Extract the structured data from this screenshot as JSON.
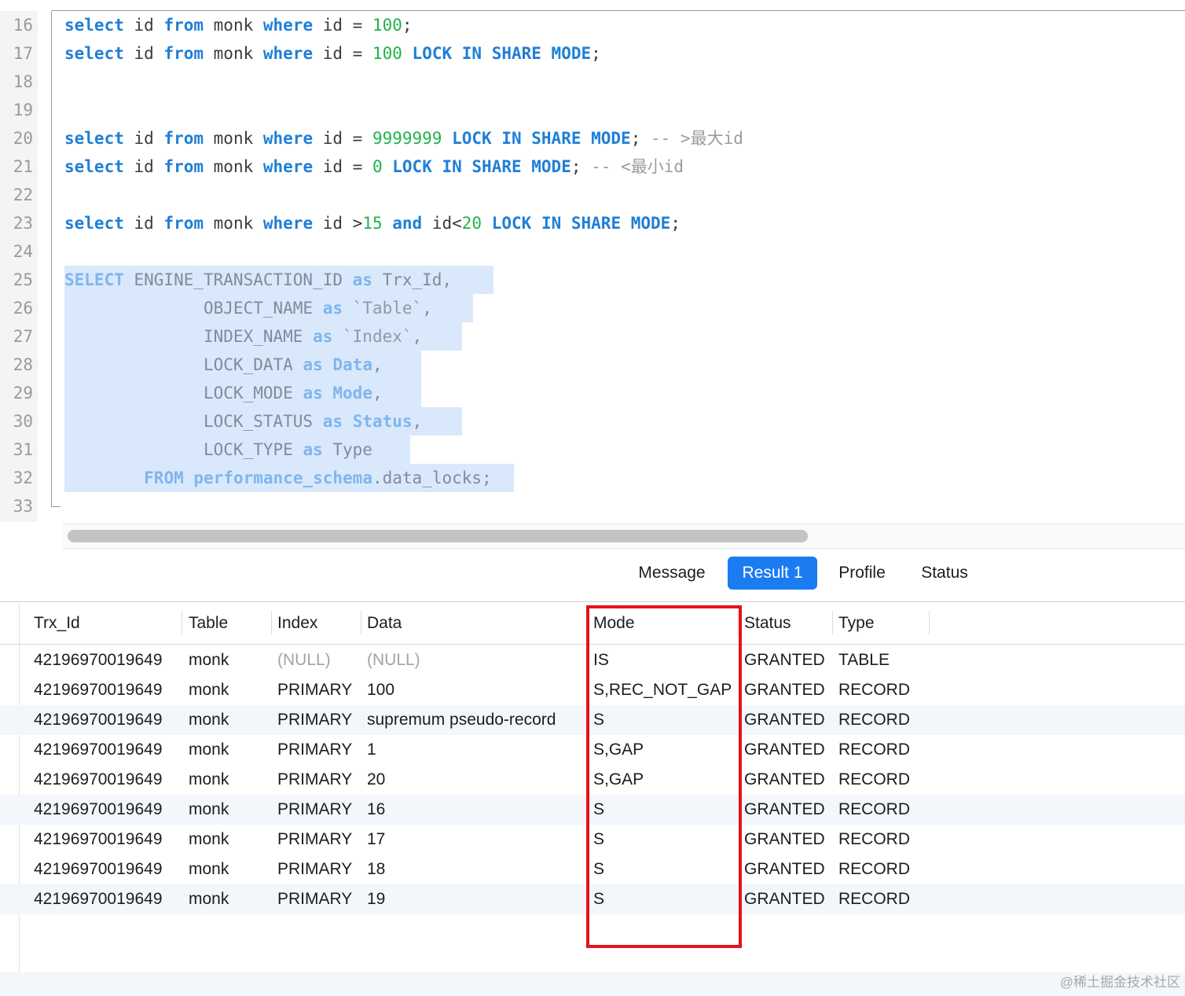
{
  "editor": {
    "lines": [
      {
        "no": "16",
        "segs": [
          [
            "k",
            "select"
          ],
          [
            "t",
            " id "
          ],
          [
            "k",
            "from"
          ],
          [
            "t",
            " monk "
          ],
          [
            "k",
            "where"
          ],
          [
            "t",
            " id = "
          ],
          [
            "n",
            "100"
          ],
          [
            "t",
            ";"
          ]
        ]
      },
      {
        "no": "17",
        "segs": [
          [
            "k",
            "select"
          ],
          [
            "t",
            " id "
          ],
          [
            "k",
            "from"
          ],
          [
            "t",
            " monk "
          ],
          [
            "k",
            "where"
          ],
          [
            "t",
            " id = "
          ],
          [
            "n",
            "100"
          ],
          [
            "t",
            " "
          ],
          [
            "k",
            "LOCK IN SHARE MODE"
          ],
          [
            "t",
            ";"
          ]
        ]
      },
      {
        "no": "18",
        "segs": []
      },
      {
        "no": "19",
        "segs": []
      },
      {
        "no": "20",
        "segs": [
          [
            "k",
            "select"
          ],
          [
            "t",
            " id "
          ],
          [
            "k",
            "from"
          ],
          [
            "t",
            " monk "
          ],
          [
            "k",
            "where"
          ],
          [
            "t",
            " id = "
          ],
          [
            "n",
            "9999999"
          ],
          [
            "t",
            " "
          ],
          [
            "k",
            "LOCK IN SHARE MODE"
          ],
          [
            "t",
            "; "
          ],
          [
            "c",
            "-- >最大id"
          ]
        ]
      },
      {
        "no": "21",
        "segs": [
          [
            "k",
            "select"
          ],
          [
            "t",
            " id "
          ],
          [
            "k",
            "from"
          ],
          [
            "t",
            " monk "
          ],
          [
            "k",
            "where"
          ],
          [
            "t",
            " id = "
          ],
          [
            "n",
            "0"
          ],
          [
            "t",
            " "
          ],
          [
            "k",
            "LOCK IN SHARE MODE"
          ],
          [
            "t",
            "; "
          ],
          [
            "c",
            "-- <最小id"
          ]
        ]
      },
      {
        "no": "22",
        "segs": []
      },
      {
        "no": "23",
        "segs": [
          [
            "k",
            "select"
          ],
          [
            "t",
            " id "
          ],
          [
            "k",
            "from"
          ],
          [
            "t",
            " monk "
          ],
          [
            "k",
            "where"
          ],
          [
            "t",
            " id >"
          ],
          [
            "n",
            "15"
          ],
          [
            "t",
            " "
          ],
          [
            "k",
            "and"
          ],
          [
            "t",
            " id<"
          ],
          [
            "n",
            "20"
          ],
          [
            "t",
            " "
          ],
          [
            "k",
            "LOCK IN SHARE MODE"
          ],
          [
            "t",
            ";"
          ]
        ]
      },
      {
        "no": "24",
        "segs": []
      },
      {
        "no": "25",
        "sel": true,
        "segs": [
          [
            "k",
            "SELECT"
          ],
          [
            "p",
            " ENGINE_TRANSACTION_ID "
          ],
          [
            "k",
            "as"
          ],
          [
            "p",
            " Trx_Id,"
          ]
        ]
      },
      {
        "no": "26",
        "sel": true,
        "segs": [
          [
            "p",
            "              OBJECT_NAME "
          ],
          [
            "k",
            "as"
          ],
          [
            "q",
            " `Table`"
          ],
          [
            "p",
            ","
          ]
        ]
      },
      {
        "no": "27",
        "sel": true,
        "segs": [
          [
            "p",
            "              INDEX_NAME "
          ],
          [
            "k",
            "as"
          ],
          [
            "q",
            " `Index`"
          ],
          [
            "p",
            ","
          ]
        ]
      },
      {
        "no": "28",
        "sel": true,
        "segs": [
          [
            "p",
            "              LOCK_DATA "
          ],
          [
            "k",
            "as"
          ],
          [
            "p",
            " "
          ],
          [
            "k",
            "Data"
          ],
          [
            "p",
            ","
          ]
        ]
      },
      {
        "no": "29",
        "sel": true,
        "segs": [
          [
            "p",
            "              LOCK_MODE "
          ],
          [
            "k",
            "as"
          ],
          [
            "p",
            " "
          ],
          [
            "k",
            "Mode"
          ],
          [
            "p",
            ","
          ]
        ]
      },
      {
        "no": "30",
        "sel": true,
        "segs": [
          [
            "p",
            "              LOCK_STATUS "
          ],
          [
            "k",
            "as"
          ],
          [
            "p",
            " "
          ],
          [
            "k",
            "Status"
          ],
          [
            "p",
            ","
          ]
        ]
      },
      {
        "no": "31",
        "sel": true,
        "segs": [
          [
            "p",
            "              LOCK_TYPE "
          ],
          [
            "k",
            "as"
          ],
          [
            "p",
            " Type"
          ]
        ]
      },
      {
        "no": "32",
        "sel": true,
        "segs": [
          [
            "p",
            "        "
          ],
          [
            "k",
            "FROM"
          ],
          [
            "p",
            " "
          ],
          [
            "k",
            "performance_schema"
          ],
          [
            "p",
            ".data_locks;"
          ]
        ]
      },
      {
        "no": "33",
        "segs": []
      }
    ]
  },
  "tabs": [
    {
      "label": "Message",
      "active": false
    },
    {
      "label": "Result 1",
      "active": true
    },
    {
      "label": "Profile",
      "active": false
    },
    {
      "label": "Status",
      "active": false
    }
  ],
  "grid": {
    "columns": [
      "Trx_Id",
      "Table",
      "Index",
      "Data",
      "Mode",
      "Status",
      "Type"
    ],
    "rows": [
      [
        "42196970019649",
        "monk",
        "(NULL)",
        "(NULL)",
        "IS",
        "GRANTED",
        "TABLE"
      ],
      [
        "42196970019649",
        "monk",
        "PRIMARY",
        "100",
        "S,REC_NOT_GAP",
        "GRANTED",
        "RECORD"
      ],
      [
        "42196970019649",
        "monk",
        "PRIMARY",
        "supremum pseudo-record",
        "S",
        "GRANTED",
        "RECORD"
      ],
      [
        "42196970019649",
        "monk",
        "PRIMARY",
        "1",
        "S,GAP",
        "GRANTED",
        "RECORD"
      ],
      [
        "42196970019649",
        "monk",
        "PRIMARY",
        "20",
        "S,GAP",
        "GRANTED",
        "RECORD"
      ],
      [
        "42196970019649",
        "monk",
        "PRIMARY",
        "16",
        "S",
        "GRANTED",
        "RECORD"
      ],
      [
        "42196970019649",
        "monk",
        "PRIMARY",
        "17",
        "S",
        "GRANTED",
        "RECORD"
      ],
      [
        "42196970019649",
        "monk",
        "PRIMARY",
        "18",
        "S",
        "GRANTED",
        "RECORD"
      ],
      [
        "42196970019649",
        "monk",
        "PRIMARY",
        "19",
        "S",
        "GRANTED",
        "RECORD"
      ]
    ],
    "null_value": "(NULL)"
  },
  "annotation": {
    "color": "#e4131a"
  },
  "watermark": "@稀土掘金技术社区",
  "colors": {
    "keyword": "#1f7fd6",
    "number": "#20b24a",
    "comment": "#9c9c9c",
    "selection": "#d9e8fb",
    "active_tab": "#1b7cf2"
  }
}
